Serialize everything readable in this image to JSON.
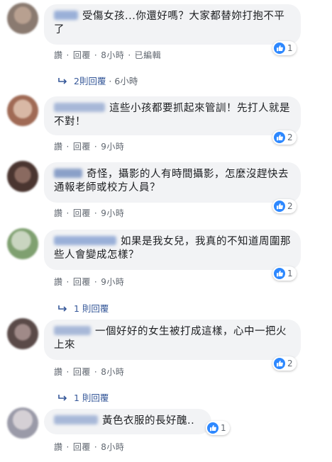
{
  "comments": [
    {
      "text": "受傷女孩...你還好嗎？大家都替妳打抱不平了",
      "like_count": "1",
      "actions": {
        "like": "讚",
        "reply": "回覆",
        "time": "8小時",
        "edited": "已編輯"
      },
      "replies": {
        "label": "2則回覆",
        "time": "6小時"
      },
      "avatar_colors": [
        "#8a7a70",
        "#b8a090"
      ]
    },
    {
      "text": "這些小孩都要抓起來管訓！先打人就是不對！",
      "like_count": "2",
      "actions": {
        "like": "讚",
        "reply": "回覆",
        "time": "9小時"
      },
      "avatar_colors": [
        "#a06a55",
        "#d8b8a5"
      ]
    },
    {
      "text": "奇怪，攝影的人有時間攝影，怎麼沒趕快去通報老師或校方人員？",
      "like_count": "2",
      "actions": {
        "like": "讚",
        "reply": "回覆",
        "time": "9小時"
      },
      "avatar_colors": [
        "#4a3530",
        "#8a6a60"
      ]
    },
    {
      "text": "如果是我女兒，我真的不知道周圍那些人會變成怎樣？",
      "like_count": "1",
      "actions": {
        "like": "讚",
        "reply": "回覆",
        "time": "9小時"
      },
      "replies": {
        "label": "1 則回覆"
      },
      "avatar_colors": [
        "#7fa070",
        "#c9d5c0"
      ]
    },
    {
      "text": "一個好好的女生被打成這樣，心中一把火上來",
      "like_count": "2",
      "actions": {
        "like": "讚",
        "reply": "回覆",
        "time": "8小時"
      },
      "replies": {
        "label": "1 則回覆"
      },
      "avatar_colors": [
        "#5a4a48",
        "#a08a88"
      ]
    },
    {
      "text": "黃色衣服的長好醜..",
      "like_count": "1",
      "actions": {
        "like": "讚",
        "reply": "回覆",
        "time": "8小時"
      },
      "avatar_colors": [
        "#9a9aa8",
        "#d5d0d5"
      ]
    }
  ],
  "colors": {
    "bubble": "#f2f3f5",
    "link": "#365899",
    "meta": "#606770",
    "like": "#2d88ff"
  }
}
